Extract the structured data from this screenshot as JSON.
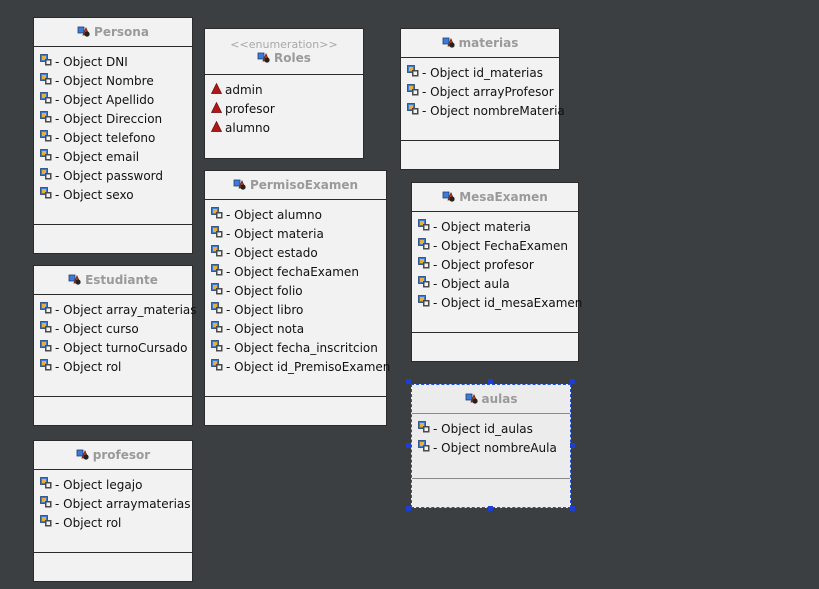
{
  "diagram": {
    "classes": [
      {
        "name": "Persona",
        "members": [
          "- Object DNI",
          "- Object Nombre",
          "- Object Apellido",
          "- Object Direccion",
          "- Object telefono",
          "- Object email",
          "- Object password",
          "- Object sexo"
        ]
      },
      {
        "stereotype": "<<enumeration>>",
        "name": "Roles",
        "literals": [
          "admin",
          "profesor",
          "alumno"
        ]
      },
      {
        "name": "materias",
        "members": [
          "- Object id_materias",
          "- Object arrayProfesor",
          "- Object nombreMateria"
        ]
      },
      {
        "name": "PermisoExamen",
        "members": [
          "- Object alumno",
          "- Object materia",
          "- Object estado",
          "- Object fechaExamen",
          "- Object folio",
          "- Object libro",
          "- Object nota",
          "- Object fecha_inscritcion",
          "- Object id_PremisoExamen"
        ]
      },
      {
        "name": "MesaExamen",
        "members": [
          "- Object materia",
          "- Object FechaExamen",
          "- Object profesor",
          "- Object aula",
          "- Object id_mesaExamen"
        ]
      },
      {
        "name": "Estudiante",
        "members": [
          "- Object array_materias",
          "- Object curso",
          "- Object turnoCursado",
          "- Object rol"
        ]
      },
      {
        "name": "aulas",
        "selected": true,
        "members": [
          "- Object id_aulas",
          "- Object nombreAula"
        ]
      },
      {
        "name": "profesor",
        "members": [
          "- Object legajo",
          "- Object arraymaterias",
          "- Object rol"
        ]
      }
    ],
    "icons": {
      "class": "class-icon",
      "attribute": "attribute-icon",
      "literal": "enum-literal-icon"
    },
    "colors": {
      "background": "#3c3f41",
      "box": "#f2f2f2",
      "title": "#9a9a9a",
      "selection": "#1f3fd0",
      "literal": "#b01818"
    }
  }
}
